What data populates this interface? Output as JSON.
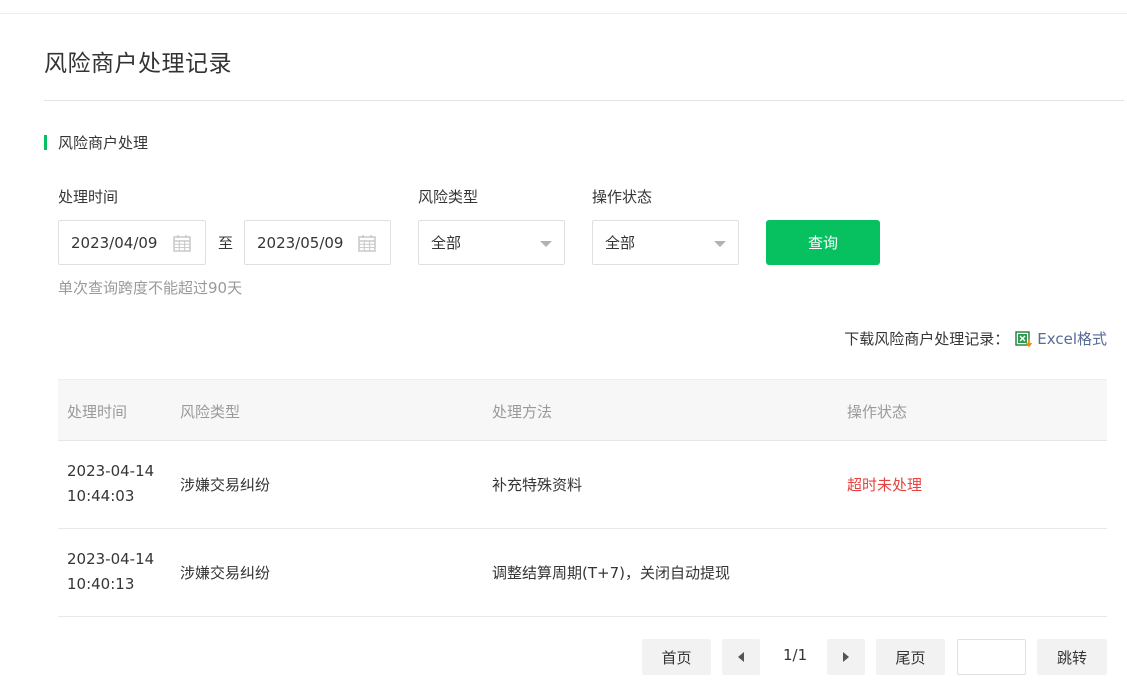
{
  "page": {
    "title": "风险商户处理记录"
  },
  "section": {
    "title": "风险商户处理"
  },
  "filters": {
    "time_label": "处理时间",
    "start_date": "2023/04/09",
    "to_label": "至",
    "end_date": "2023/05/09",
    "risk_type_label": "风险类型",
    "risk_type_value": "全部",
    "status_label": "操作状态",
    "status_value": "全部",
    "query_label": "查询",
    "hint": "单次查询跨度不能超过90天"
  },
  "download": {
    "label": "下载风险商户处理记录：",
    "link": "Excel格式"
  },
  "table": {
    "headers": [
      "处理时间",
      "风险类型",
      "处理方法",
      "操作状态"
    ],
    "rows": [
      {
        "time": "2023-04-14 10:44:03",
        "type": "涉嫌交易纠纷",
        "method": "补充特殊资料",
        "status": "超时未处理"
      },
      {
        "time": "2023-04-14 10:40:13",
        "type": "涉嫌交易纠纷",
        "method": "调整结算周期(T+7)，关闭自动提现",
        "status": ""
      }
    ]
  },
  "pagination": {
    "first": "首页",
    "current": "1/1",
    "last": "尾页",
    "jump": "跳转",
    "jump_value": ""
  },
  "colors": {
    "accent": "#07c160",
    "danger": "#e64340",
    "link": "#576b95"
  }
}
